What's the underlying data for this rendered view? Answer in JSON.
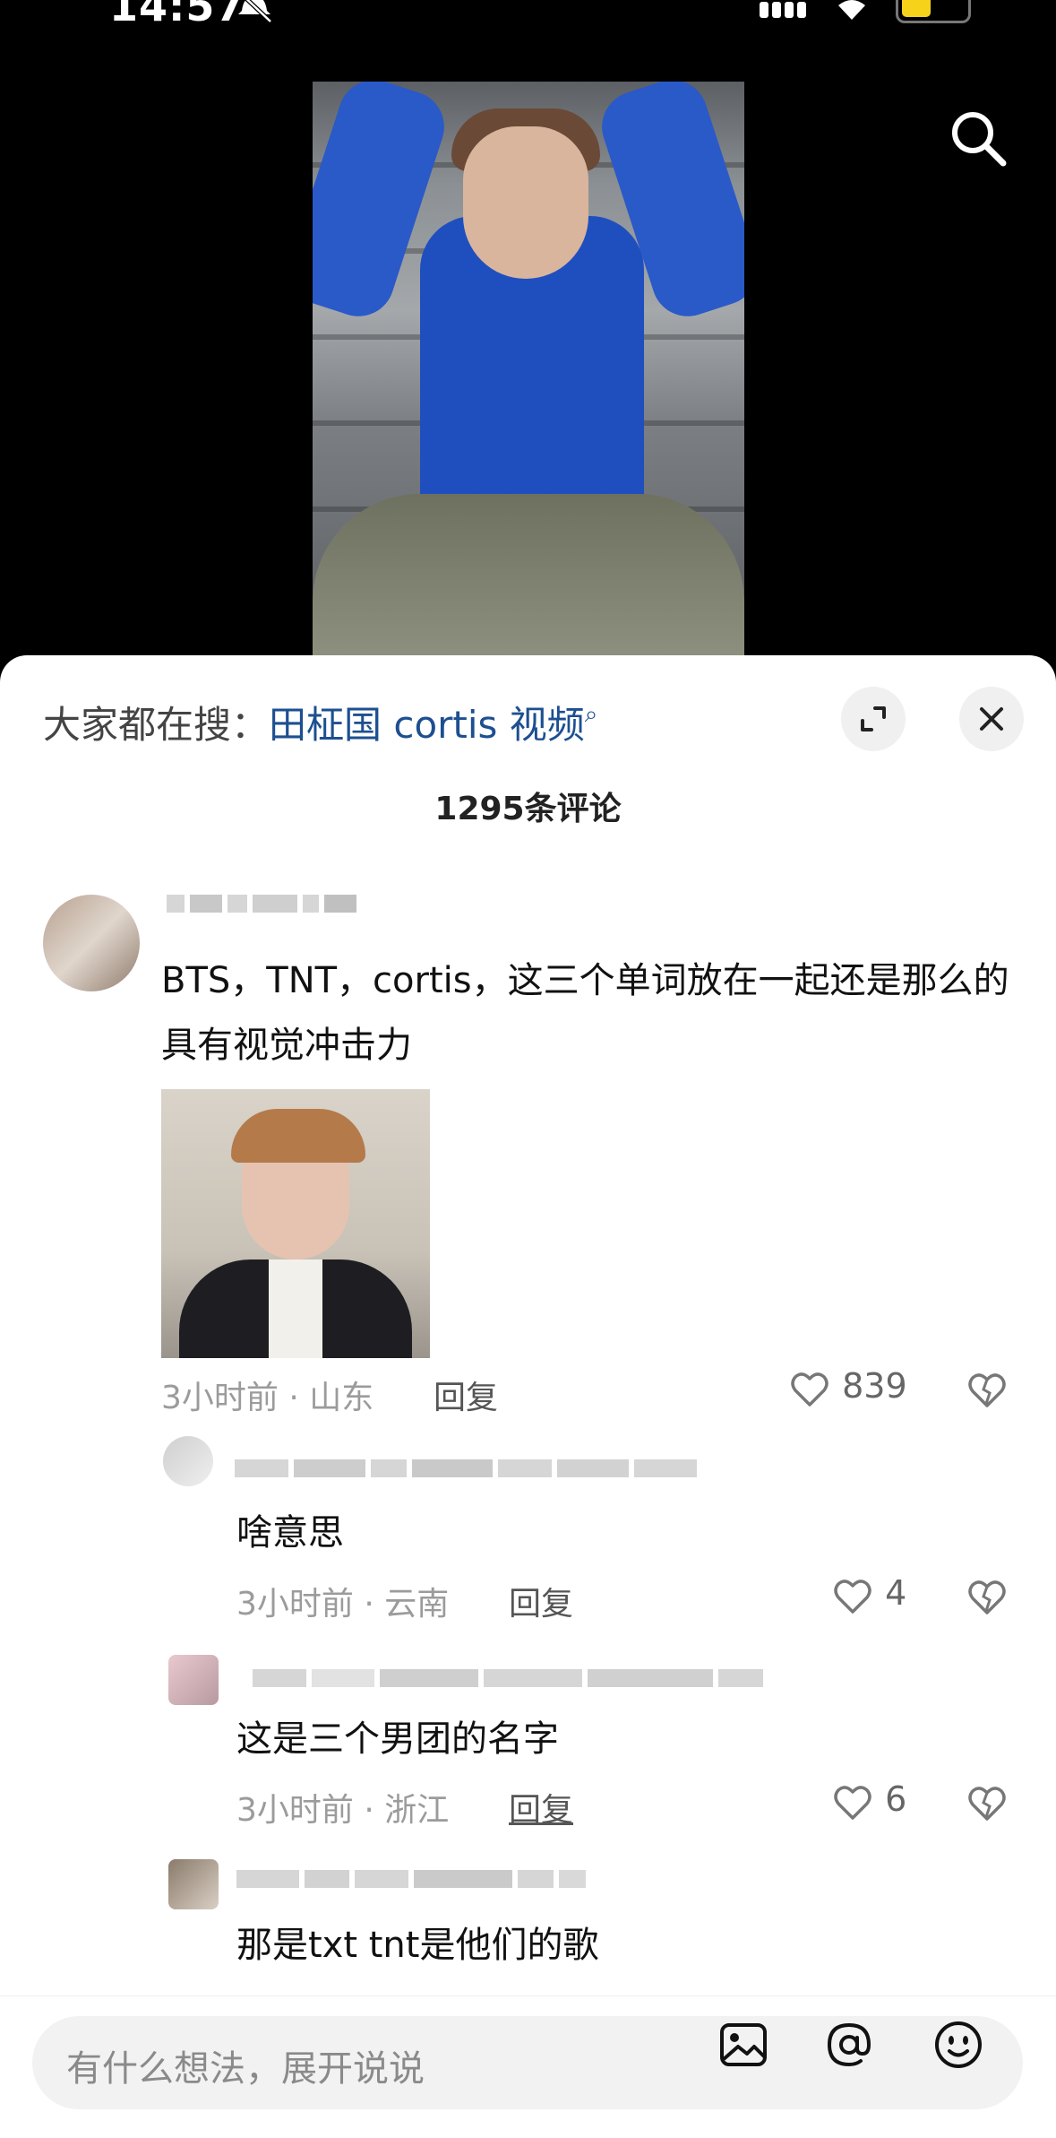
{
  "status_bar": {
    "time": "14:57"
  },
  "trending": {
    "prefix": "大家都在搜：",
    "query": "田柾国 cortis 视频"
  },
  "comments_header": {
    "count_label": "1295条评论"
  },
  "comment_main": {
    "text": "BTS，TNT，cortis，这三个单词放在一起还是那么的具有视觉冲击力",
    "meta": "3小时前 · 山东",
    "reply_label": "回复",
    "likes": "839"
  },
  "replies": [
    {
      "text": "啥意思",
      "meta": "3小时前 · 云南",
      "reply_label": "回复",
      "likes": "4"
    },
    {
      "text": "这是三个男团的名字",
      "meta": "3小时前 · 浙江",
      "reply_label": "回复",
      "likes": "6"
    },
    {
      "text": "那是txt tnt是他们的歌"
    }
  ],
  "input_bar": {
    "placeholder": "有什么想法，展开说说"
  },
  "icons": {
    "search": "search-icon",
    "expand": "expand-icon",
    "close": "close-icon",
    "heart": "heart-icon",
    "broken_heart": "broken-heart-icon",
    "image": "image-icon",
    "at": "at-icon",
    "emoji": "emoji-icon"
  },
  "colors": {
    "link": "#1d4f91",
    "sheet": "#ffffff",
    "background": "#000000"
  }
}
